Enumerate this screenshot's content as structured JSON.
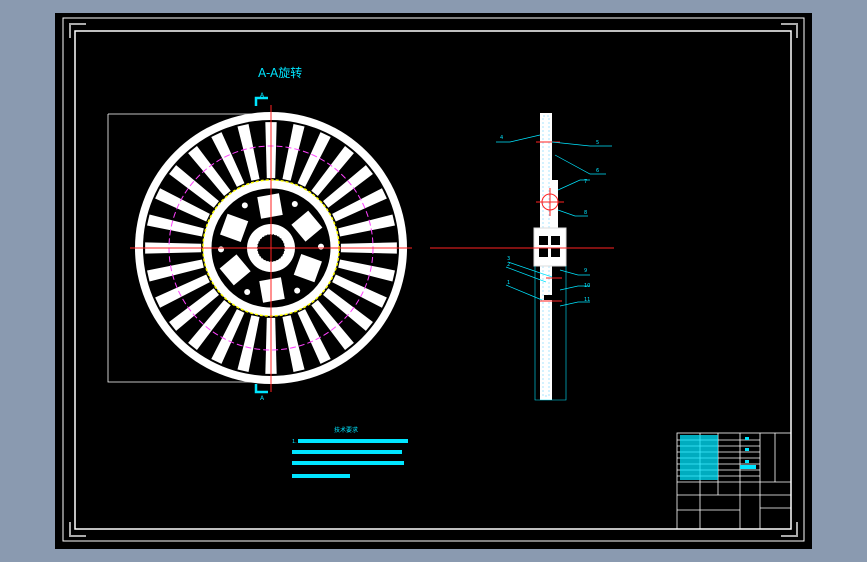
{
  "drawing": {
    "section_title": "A-A旋转",
    "section_marks": [
      "A",
      "A"
    ],
    "notes_title": "技术要求",
    "notes_first_item": "1.",
    "balloons": [
      "1",
      "2",
      "3",
      "4",
      "5",
      "6",
      "7",
      "8",
      "9",
      "10",
      "11"
    ]
  },
  "colors": {
    "background": "#8a9ab0",
    "canvas": "#000000",
    "outline": "#ffffff",
    "centerline": "#ff2020",
    "leader": "#00e5ff",
    "hidden": "#ff40ff",
    "accent": "#ffff00"
  }
}
